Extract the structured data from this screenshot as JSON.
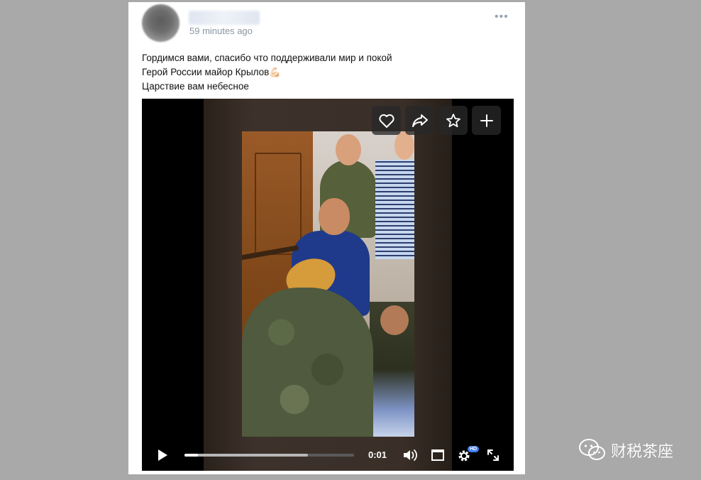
{
  "post": {
    "timestamp": "59 minutes ago",
    "more_menu": "•••",
    "text_lines": [
      "Гордимся вами, спасибо что поддерживали мир и покой",
      "Герой России майор Крылов💪🏻",
      "Царствие вам небесное"
    ]
  },
  "video": {
    "actions": [
      {
        "icon": "heart-icon"
      },
      {
        "icon": "share-icon"
      },
      {
        "icon": "star-icon"
      },
      {
        "icon": "plus-icon"
      }
    ],
    "controls": {
      "time": "0:01",
      "hd_badge": "HD",
      "progress_played": 0.08,
      "progress_buffered": 0.73
    }
  },
  "watermark": {
    "text": "财税茶座",
    "icon": "wechat-icon"
  },
  "colors": {
    "page_background": "#a9a9a9",
    "card_background": "#ffffff",
    "timestamp": "#8a95a3",
    "hd_badge": "#3f7ef0"
  }
}
